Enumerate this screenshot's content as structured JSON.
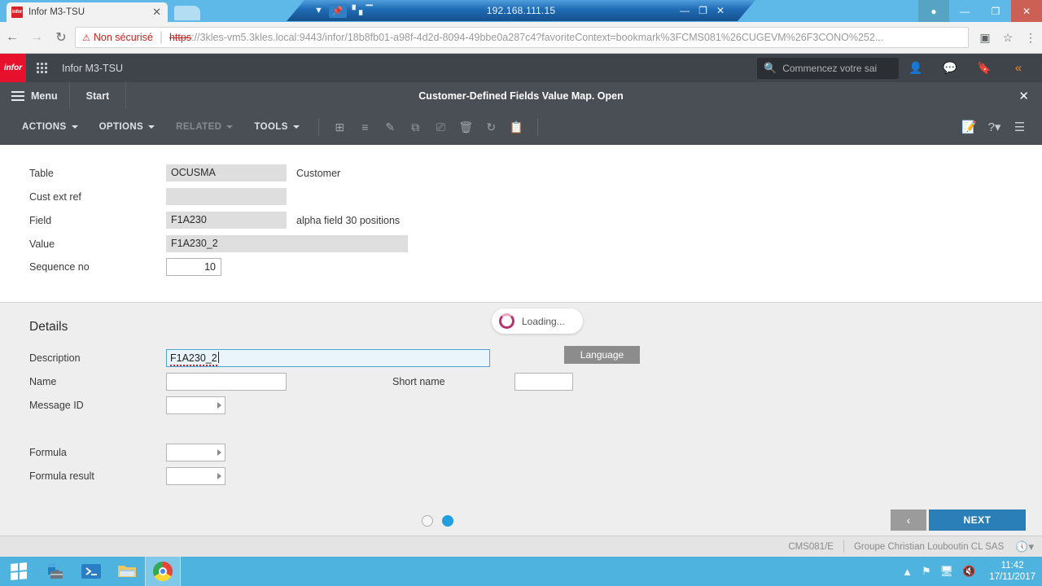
{
  "rdp": {
    "ip": "192.168.111.15",
    "chevron_icon": "chevron-down-icon",
    "pin_icon": "pin-icon",
    "signal_icon": "signal-bars-icon",
    "minimize": "—",
    "restore": "❐",
    "close": "✕"
  },
  "browser": {
    "tab_title": "Infor M3-TSU",
    "tab_favicon_text": "infor",
    "tab_close": "✕",
    "back_icon": "←",
    "forward_icon": "→",
    "reload_icon": "↻",
    "insecure_icon": "⚠",
    "insecure_label": "Non sécurisé",
    "url_scheme": "https",
    "url_rest": "://3kles-vm5.3kles.local:9443/infor/18b8fb01-a98f-4d2d-8094-49bbe0a287c4?favoriteContext=bookmark%3FCMS081%26CUGEVM%26F3CONO%252...",
    "url_host_bold": "3kles-vm5.3kles.local",
    "translate_icon": "translate-icon",
    "star_icon": "☆",
    "menu_icon": "⋮",
    "window_user": "●",
    "window_minimize": "—",
    "window_maximize": "❐",
    "window_close": "✕"
  },
  "infor_header": {
    "logo_text": "infor",
    "grid_icon": "app-grid-icon",
    "app_name": "Infor M3-TSU",
    "search_placeholder": "Commencez votre sai",
    "search_icon": "search-icon",
    "user_icon": "user-icon",
    "chat_icon": "chat-icon",
    "bookmark_icon": "bookmark-icon",
    "collapse_icon": "«"
  },
  "titlebar": {
    "menu_label": "Menu",
    "start_label": "Start",
    "form_title": "Customer-Defined Fields Value Map. Open",
    "close_icon": "✕"
  },
  "actionbar": {
    "menus": [
      {
        "label": "ACTIONS",
        "disabled": false
      },
      {
        "label": "OPTIONS",
        "disabled": false
      },
      {
        "label": "RELATED",
        "disabled": true
      },
      {
        "label": "TOOLS",
        "disabled": false
      }
    ],
    "tools": [
      {
        "name": "add-icon",
        "glyph": "⊞"
      },
      {
        "name": "select-list-icon",
        "glyph": "☰"
      },
      {
        "name": "edit-pencil-icon",
        "glyph": "✎"
      },
      {
        "name": "copy-icon",
        "glyph": "⧉"
      },
      {
        "name": "duplicate-icon",
        "glyph": "❐"
      },
      {
        "name": "delete-trash-icon",
        "glyph": "Ὕ1"
      },
      {
        "name": "refresh-icon",
        "glyph": "↻"
      },
      {
        "name": "clipboard-icon",
        "glyph": "Ὄb"
      }
    ],
    "right_tools": [
      {
        "name": "note-edit-icon",
        "glyph": "✎"
      },
      {
        "name": "help-icon",
        "glyph": "?"
      },
      {
        "name": "hamburger-menu-icon",
        "glyph": "☰"
      }
    ]
  },
  "form": {
    "fields": [
      {
        "label": "Table",
        "value": "OCUSMA",
        "suffix": "Customer"
      },
      {
        "label": "Cust ext ref",
        "value": "",
        "suffix": ""
      },
      {
        "label": "Field",
        "value": "F1A230",
        "suffix": "alpha field 30 positions"
      },
      {
        "label": "Value",
        "value": "F1A230_2",
        "suffix": ""
      },
      {
        "label": "Sequence no",
        "value": "10",
        "suffix": ""
      }
    ]
  },
  "details": {
    "heading": "Details",
    "loading_text": "Loading...",
    "loading_spinner_color": "#b8326e",
    "description_label": "Description",
    "description_value": "F1A230_2",
    "language_button": "Language",
    "name_label": "Name",
    "name_value": "",
    "short_name_label": "Short name",
    "short_name_value": "",
    "message_id_label": "Message ID",
    "message_id_value": "",
    "formula_label": "Formula",
    "formula_value": "",
    "formula_result_label": "Formula result",
    "formula_result_value": ""
  },
  "pager": {
    "dots": [
      {
        "active": false
      },
      {
        "active": true
      }
    ],
    "prev_label": "‹",
    "next_label": "NEXT",
    "next_color": "#2a7fb8"
  },
  "statusbar": {
    "program": "CMS081/E",
    "company": "Groupe Christian Louboutin CL SAS",
    "clock_icon": "clock-icon"
  },
  "taskbar": {
    "start_icon": "windows-start-icon",
    "apps": [
      {
        "name": "server-manager-icon",
        "active": false
      },
      {
        "name": "powershell-icon",
        "active": false
      },
      {
        "name": "file-explorer-icon",
        "active": false
      },
      {
        "name": "chrome-icon",
        "active": true
      }
    ],
    "tray": {
      "expand_icon": "▲",
      "flag_icon": "⚑",
      "network_icon": "network-icon",
      "volume_muted_icon": "volume-muted-icon"
    },
    "time": "11:42",
    "date": "17/11/2017"
  }
}
